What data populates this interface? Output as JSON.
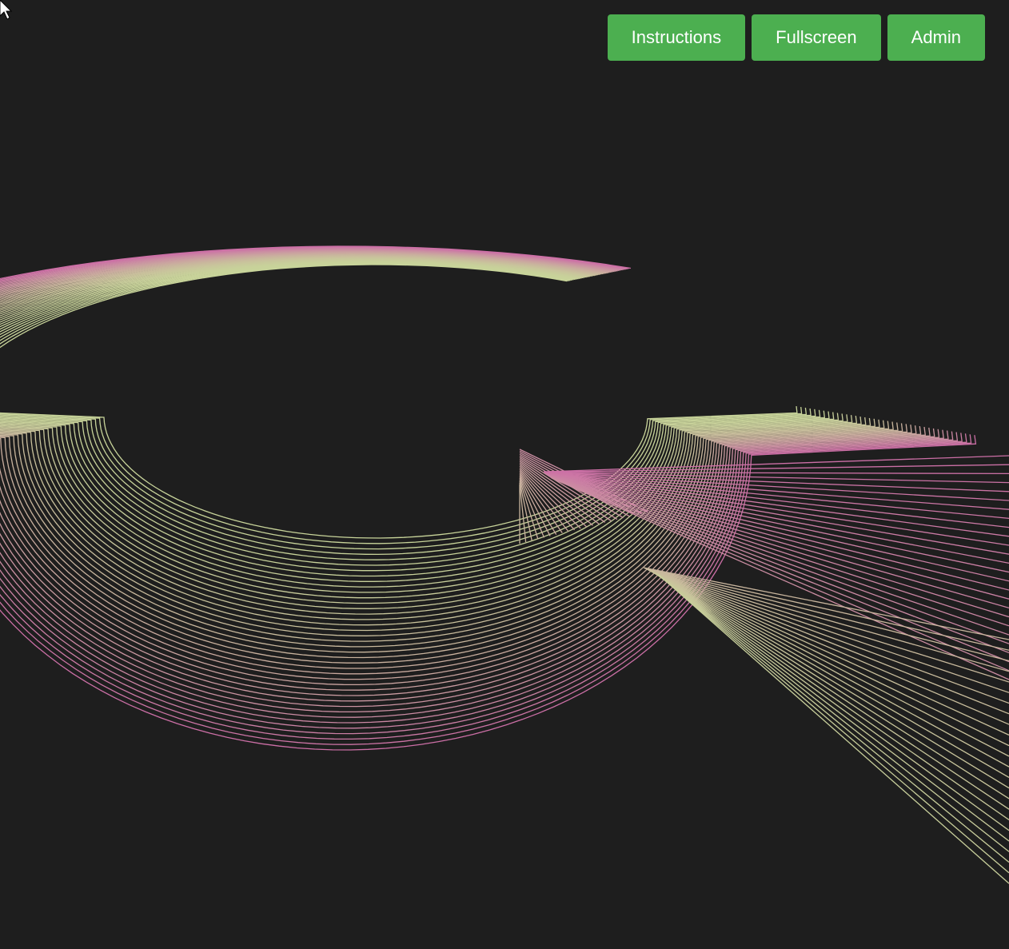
{
  "toolbar": {
    "buttons": [
      {
        "label": "Instructions"
      },
      {
        "label": "Fullscreen"
      },
      {
        "label": "Admin"
      }
    ]
  },
  "colors": {
    "background": "#1e1e1e",
    "button": "#4caf50",
    "button_text": "#ffffff",
    "line_green": "#c8d49a",
    "line_pink": "#cc6fa6"
  },
  "icons": {
    "cursor": "mouse-pointer-icon"
  }
}
